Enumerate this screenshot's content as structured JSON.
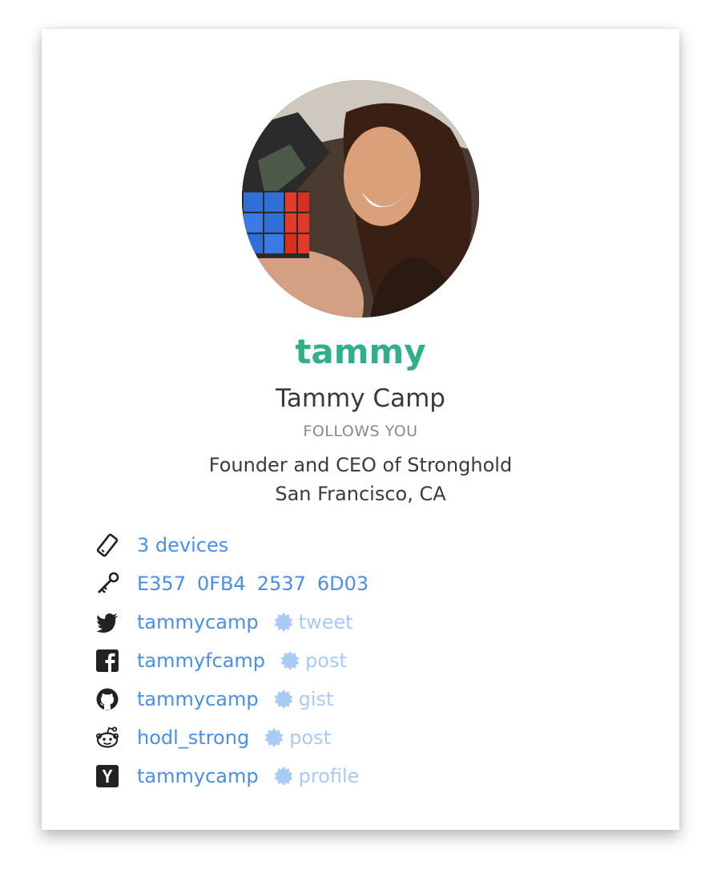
{
  "profile": {
    "username": "tammy",
    "full_name": "Tammy Camp",
    "follow_status": "FOLLOWS YOU",
    "bio_line_1": "Founder and CEO of Stronghold",
    "bio_line_2": "San Francisco, CA",
    "colors": {
      "username": "#2fb08a",
      "link": "#4a8ee6",
      "proof": "#a9caf3"
    }
  },
  "identities": {
    "devices": {
      "icon": "phone-icon",
      "label": "3 devices"
    },
    "key": {
      "icon": "key-icon",
      "fingerprint": [
        "E357",
        "0FB4",
        "2537",
        "6D03"
      ]
    },
    "twitter": {
      "icon": "twitter-icon",
      "handle": "tammycamp",
      "proof_icon": "verified-badge-icon",
      "proof": "tweet"
    },
    "facebook": {
      "icon": "facebook-icon",
      "handle": "tammyfcamp",
      "proof_icon": "verified-badge-icon",
      "proof": "post"
    },
    "github": {
      "icon": "github-icon",
      "handle": "tammycamp",
      "proof_icon": "verified-badge-icon",
      "proof": "gist"
    },
    "reddit": {
      "icon": "reddit-icon",
      "handle": "hodl_strong",
      "proof_icon": "verified-badge-icon",
      "proof": "post"
    },
    "hackernews": {
      "icon": "hackernews-icon",
      "handle": "tammycamp",
      "proof_icon": "verified-badge-icon",
      "proof": "profile"
    }
  }
}
